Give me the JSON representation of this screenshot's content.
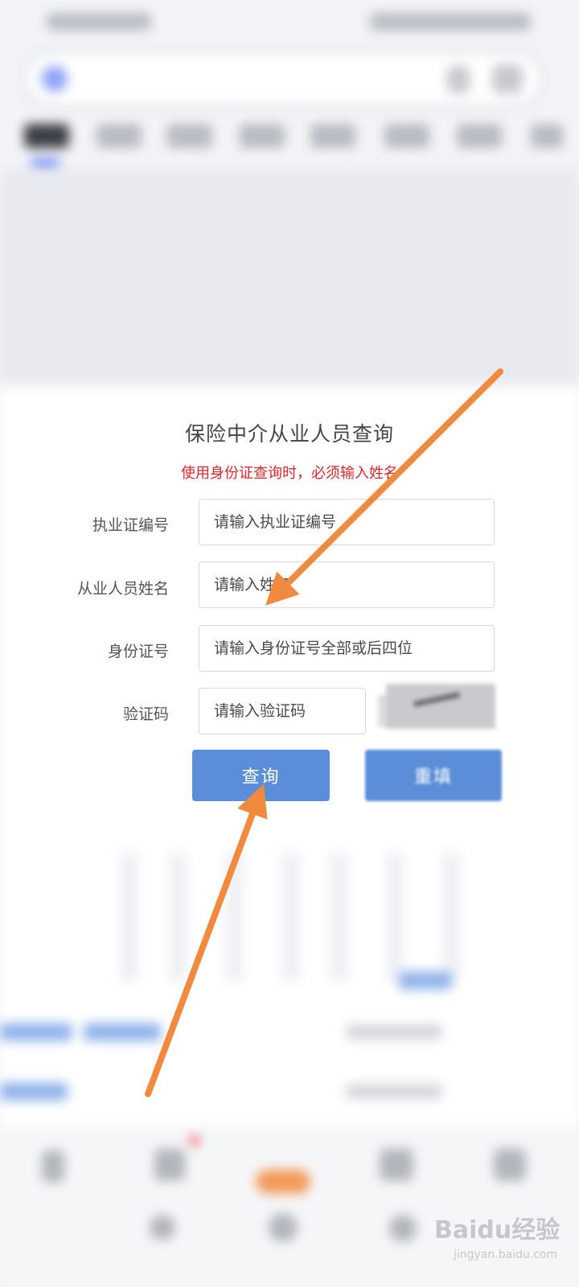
{
  "dialog": {
    "title": "保险中介从业人员查询",
    "warning": "使用身份证查询时，必须输入姓名",
    "fields": [
      {
        "label": "执业证编号",
        "placeholder": "请输入执业证编号",
        "value": ""
      },
      {
        "label": "从业人员姓名",
        "placeholder": "请输入姓名",
        "value": ""
      },
      {
        "label": "身份证号",
        "placeholder": "请输入身份证号全部或后四位",
        "value": ""
      },
      {
        "label": "验证码",
        "placeholder": "请输入验证码",
        "value": ""
      }
    ],
    "query_button": "查询",
    "reset_button": "重填"
  },
  "watermark": {
    "main": "Baidu经验",
    "sub": "jingyan.baidu.com"
  },
  "colors": {
    "button": "#5b8ed8",
    "warning": "#e0262a",
    "arrow": "#f08a3e"
  }
}
